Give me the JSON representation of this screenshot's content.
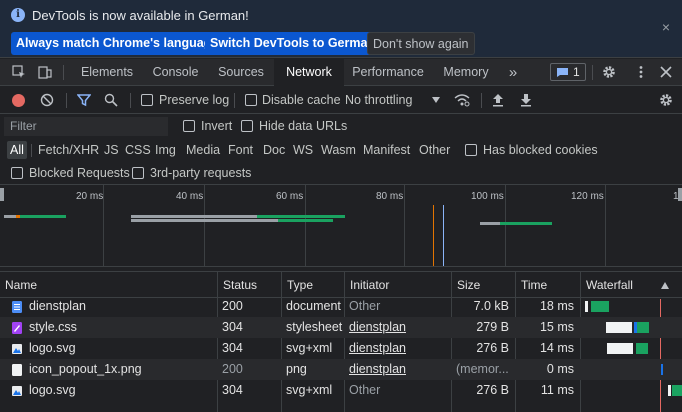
{
  "infobar": {
    "message": "DevTools is now available in German!",
    "btn_match": "Always match Chrome's language",
    "btn_switch": "Switch DevTools to German",
    "btn_dismiss": "Don't show again",
    "close": "×"
  },
  "tabs": {
    "items": [
      "Elements",
      "Console",
      "Sources",
      "Network",
      "Performance",
      "Memory"
    ],
    "more": "»",
    "issues_count": "1",
    "active": "Network"
  },
  "toolbar": {
    "preserve_log": "Preserve log",
    "disable_cache": "Disable cache",
    "throttling": "No throttling"
  },
  "filter": {
    "placeholder": "Filter",
    "invert": "Invert",
    "hide_data_urls": "Hide data URLs",
    "types": [
      "All",
      "Fetch/XHR",
      "JS",
      "CSS",
      "Img",
      "Media",
      "Font",
      "Doc",
      "WS",
      "Wasm",
      "Manifest",
      "Other"
    ],
    "has_blocked_cookies": "Has blocked cookies",
    "blocked_requests": "Blocked Requests",
    "third_party": "3rd-party requests"
  },
  "overview": {
    "ticks": [
      "20 ms",
      "40 ms",
      "60 ms",
      "80 ms",
      "100 ms",
      "120 ms"
    ]
  },
  "table": {
    "headers": [
      "Name",
      "Status",
      "Type",
      "Initiator",
      "Size",
      "Time",
      "Waterfall"
    ],
    "rows": [
      {
        "name": "dienstplan",
        "status": "200",
        "type": "document",
        "initiator": "Other",
        "size": "7.0 kB",
        "time": "18 ms",
        "icon": "document-icon"
      },
      {
        "name": "style.css",
        "status": "304",
        "type": "stylesheet",
        "initiator": "dienstplan",
        "size": "279 B",
        "time": "15 ms",
        "icon": "stylesheet-icon"
      },
      {
        "name": "logo.svg",
        "status": "304",
        "type": "svg+xml",
        "initiator": "dienstplan",
        "size": "276 B",
        "time": "14 ms",
        "icon": "image-icon"
      },
      {
        "name": "icon_popout_1x.png",
        "status": "200",
        "type": "png",
        "initiator": "dienstplan",
        "size": "(memor...",
        "time": "0 ms",
        "icon": "image-icon"
      },
      {
        "name": "logo.svg",
        "status": "304",
        "type": "svg+xml",
        "initiator": "Other",
        "size": "276 B",
        "time": "11 ms",
        "icon": "image-icon"
      }
    ]
  },
  "colors": {
    "accent": "#8ab4f8",
    "record": "#e46962",
    "waterfall_green": "#1aa260",
    "waterfall_blue": "#1a73e8"
  }
}
